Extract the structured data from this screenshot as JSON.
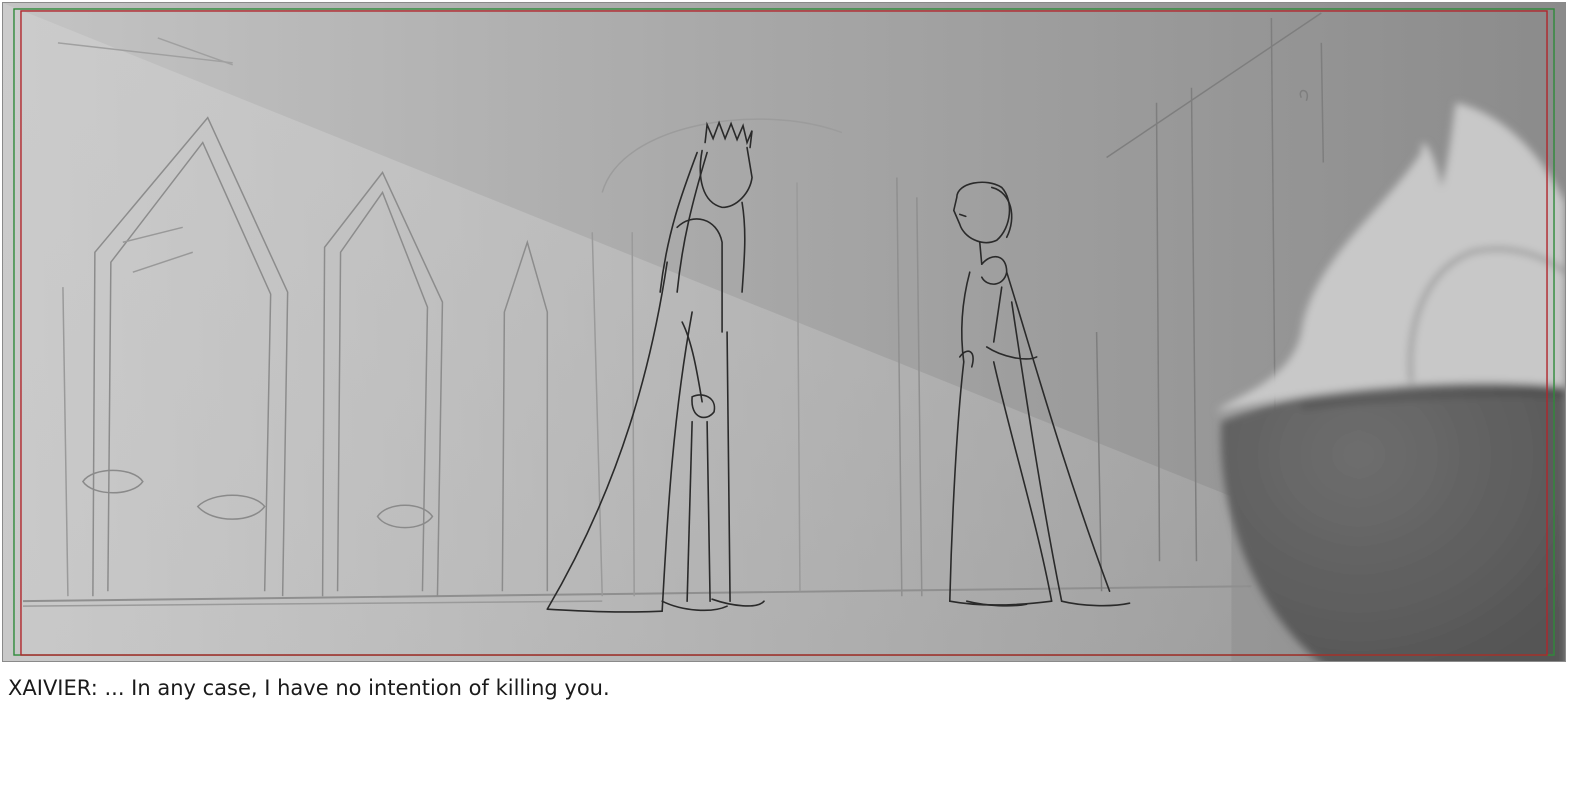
{
  "storyboard": {
    "panel": {
      "caption": "XAIVIER: ... In any case, I have no intention of killing you."
    },
    "colors": {
      "safe_area_red": "#b0262c",
      "safe_area_green": "#2f8a3a",
      "sketch_line": "#2a2a2a"
    }
  }
}
